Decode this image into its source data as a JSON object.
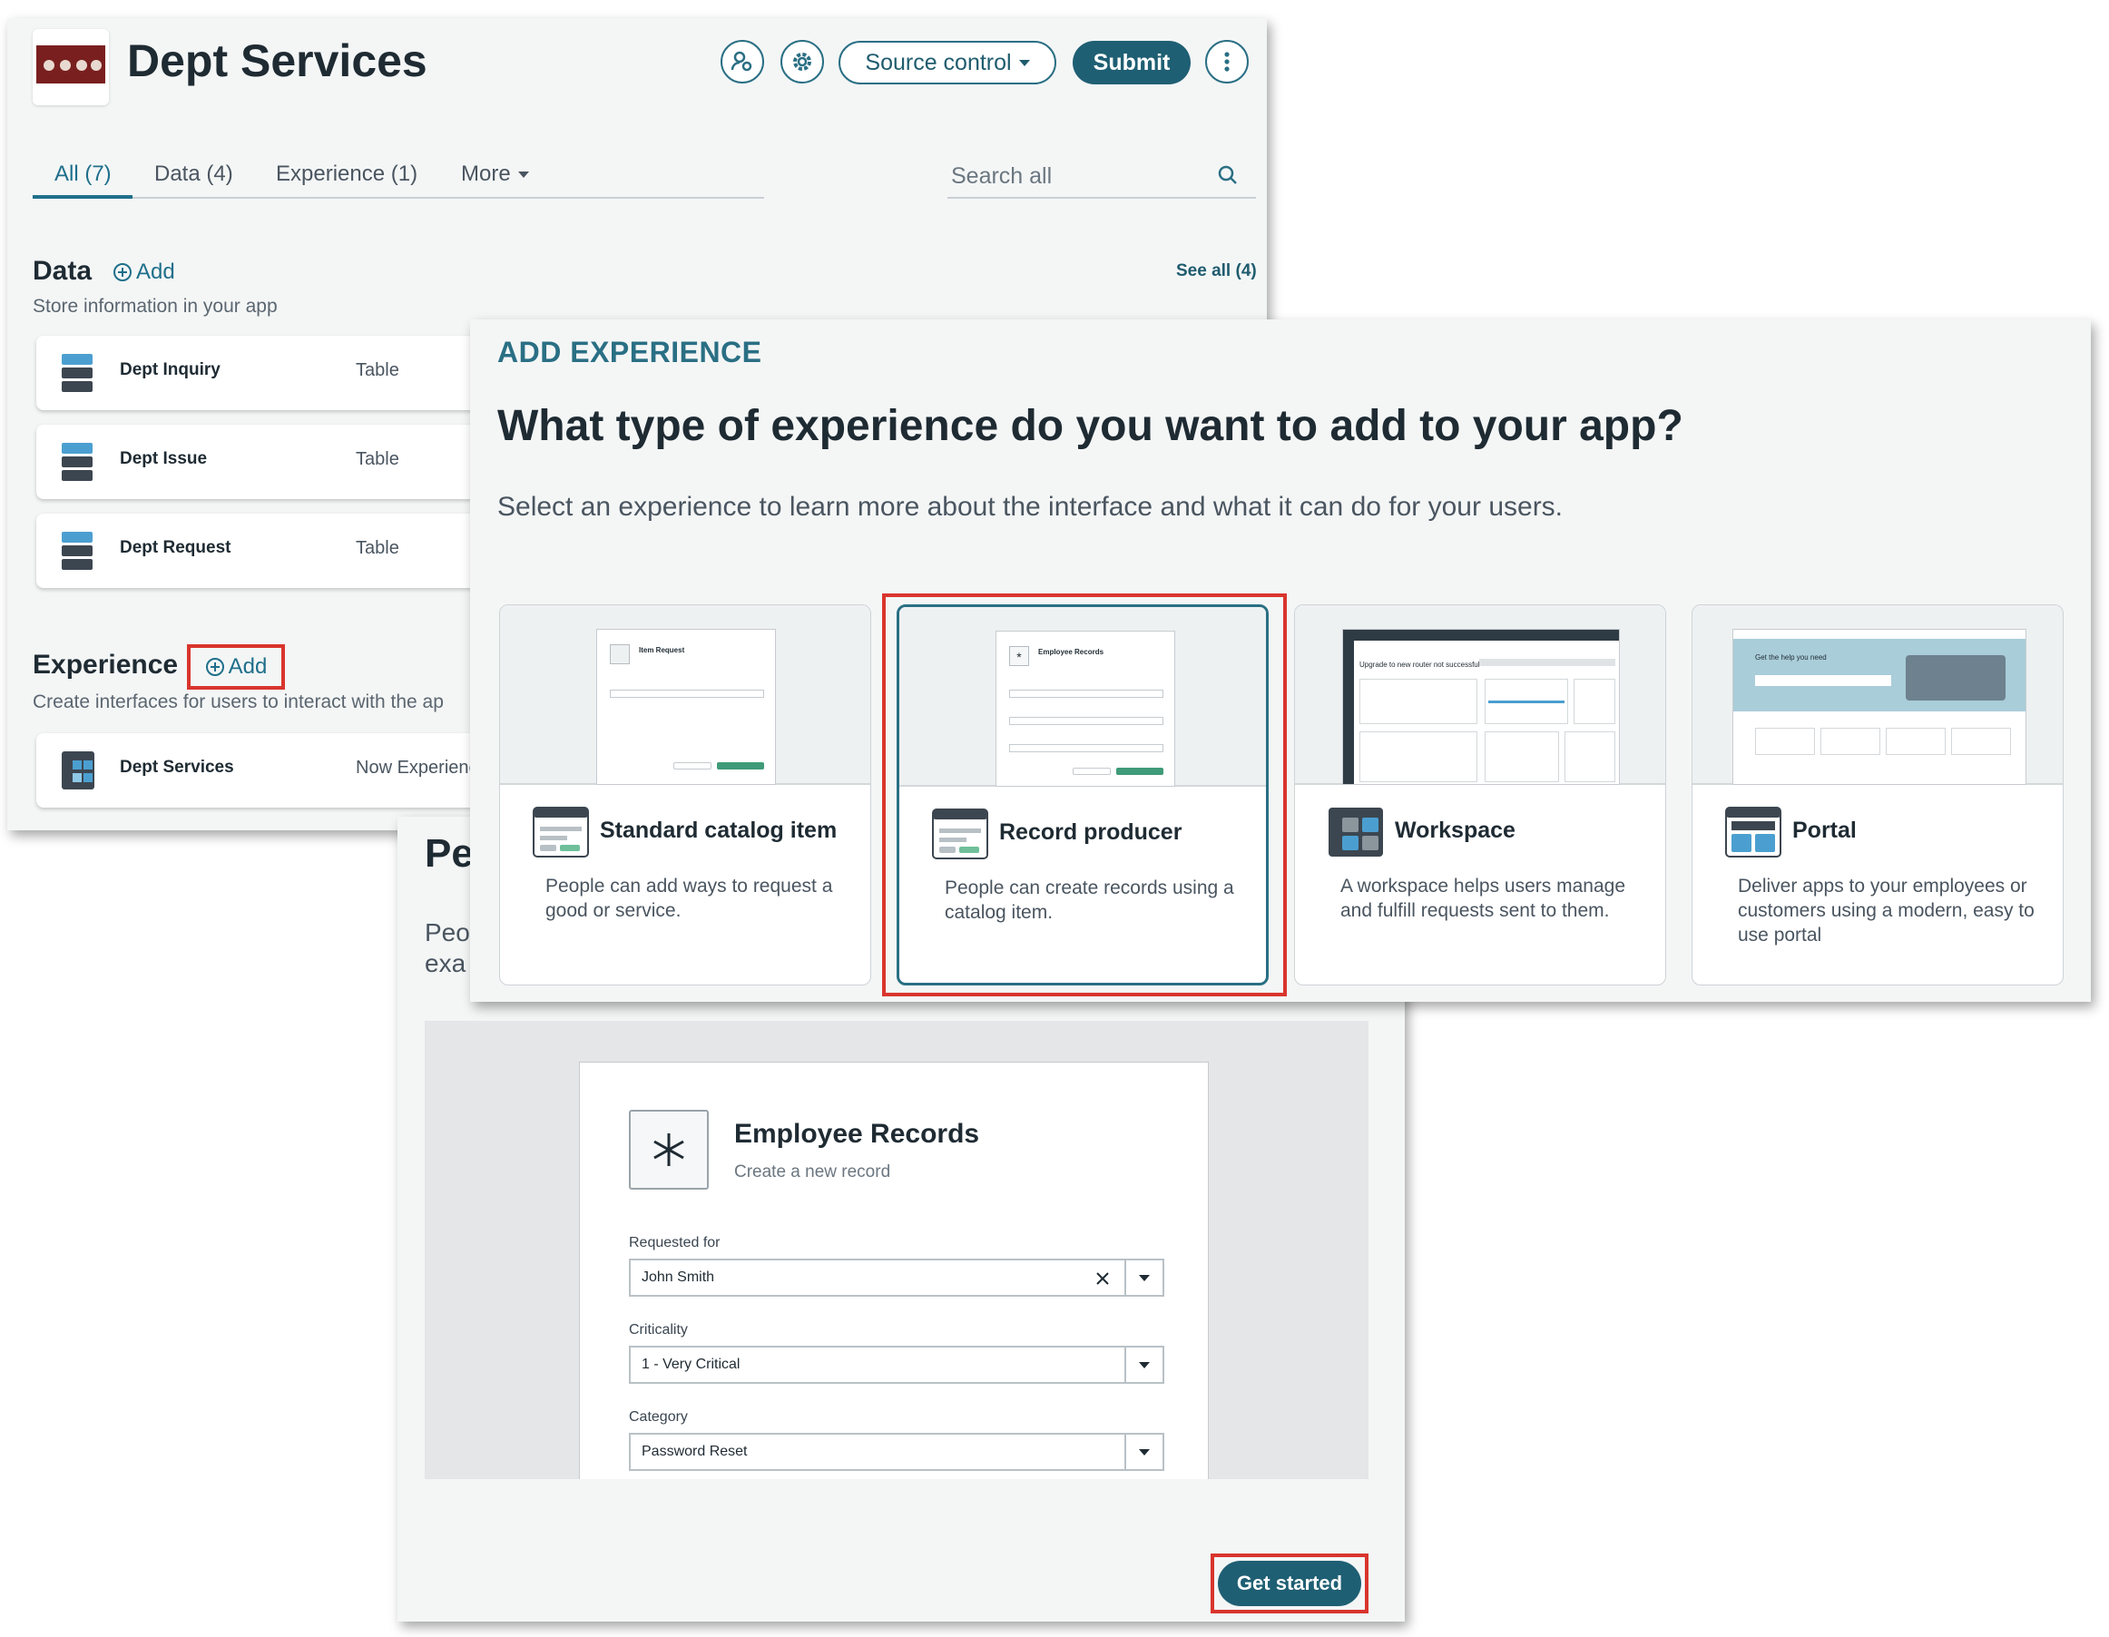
{
  "app": {
    "title": "Dept Services",
    "source_control_label": "Source control",
    "submit_label": "Submit",
    "tabs": [
      {
        "label": "All (7)"
      },
      {
        "label": "Data (4)"
      },
      {
        "label": "Experience (1)"
      },
      {
        "label": "More"
      }
    ],
    "search_placeholder": "Search all",
    "data_section": {
      "title": "Data",
      "add_label": "Add",
      "subtitle": "Store information in your app",
      "see_all": "See all (4)",
      "rows": [
        {
          "name": "Dept Inquiry",
          "type": "Table"
        },
        {
          "name": "Dept Issue",
          "type": "Table"
        },
        {
          "name": "Dept Request",
          "type": "Table"
        }
      ]
    },
    "experience_section": {
      "title": "Experience",
      "add_label": "Add",
      "subtitle": "Create interfaces for users to interact with the ap",
      "rows": [
        {
          "name": "Dept Services",
          "type": "Now Experience"
        }
      ]
    }
  },
  "preview": {
    "partial_heading": "Pe",
    "partial_line1": "Peo",
    "partial_line2": "exa",
    "form_title": "Employee Records",
    "form_subtitle": "Create a new record",
    "fields": [
      {
        "label": "Requested for",
        "value": "John Smith"
      },
      {
        "label": "Criticality",
        "value": "1 - Very Critical"
      },
      {
        "label": "Category",
        "value": "Password Reset"
      }
    ],
    "get_started_label": "Get started"
  },
  "modal": {
    "eyebrow": "ADD EXPERIENCE",
    "heading": "What type of experience do you want to add to your app?",
    "description": "Select an experience to learn more about the interface and what it can do for your users.",
    "options": [
      {
        "title": "Standard catalog item",
        "description": "People can add ways to request a good or service.",
        "thumb_title": "Item Request"
      },
      {
        "title": "Record producer",
        "description": "People can create records using a catalog item.",
        "thumb_title": "Employee Records",
        "selected": true
      },
      {
        "title": "Workspace",
        "description": "A workspace helps users manage and fulfill requests sent to them.",
        "thumb_title": "Upgrade to new router not successful"
      },
      {
        "title": "Portal",
        "description": "Deliver apps to your employees or customers using a modern, easy to use portal",
        "thumb_title": "Get the help you need"
      }
    ]
  },
  "colors": {
    "accent": "#1f5f73",
    "highlight": "#d9352d",
    "panel_bg": "#f4f6f6"
  }
}
